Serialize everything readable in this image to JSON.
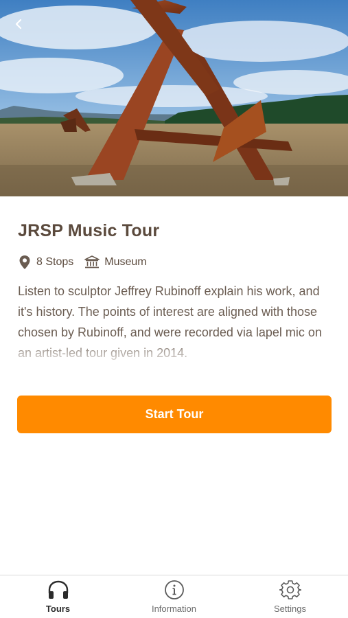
{
  "tour": {
    "title": "JRSP Music Tour",
    "stops": "8 Stops",
    "category": "Museum",
    "description": "Listen to sculptor Jeffrey Rubinoff explain his work, and it's history. The points of interest are aligned with those chosen by Rubinoff, and were recorded via lapel mic on an artist-led tour given in 2014."
  },
  "actions": {
    "start_label": "Start Tour"
  },
  "tabbar": {
    "tabs": [
      {
        "label": "Tours",
        "icon": "headphones-icon",
        "active": true
      },
      {
        "label": "Information",
        "icon": "info-icon",
        "active": false
      },
      {
        "label": "Settings",
        "icon": "gear-icon",
        "active": false
      }
    ]
  },
  "colors": {
    "accent": "#ff8a00",
    "text": "#5b4a3d"
  }
}
